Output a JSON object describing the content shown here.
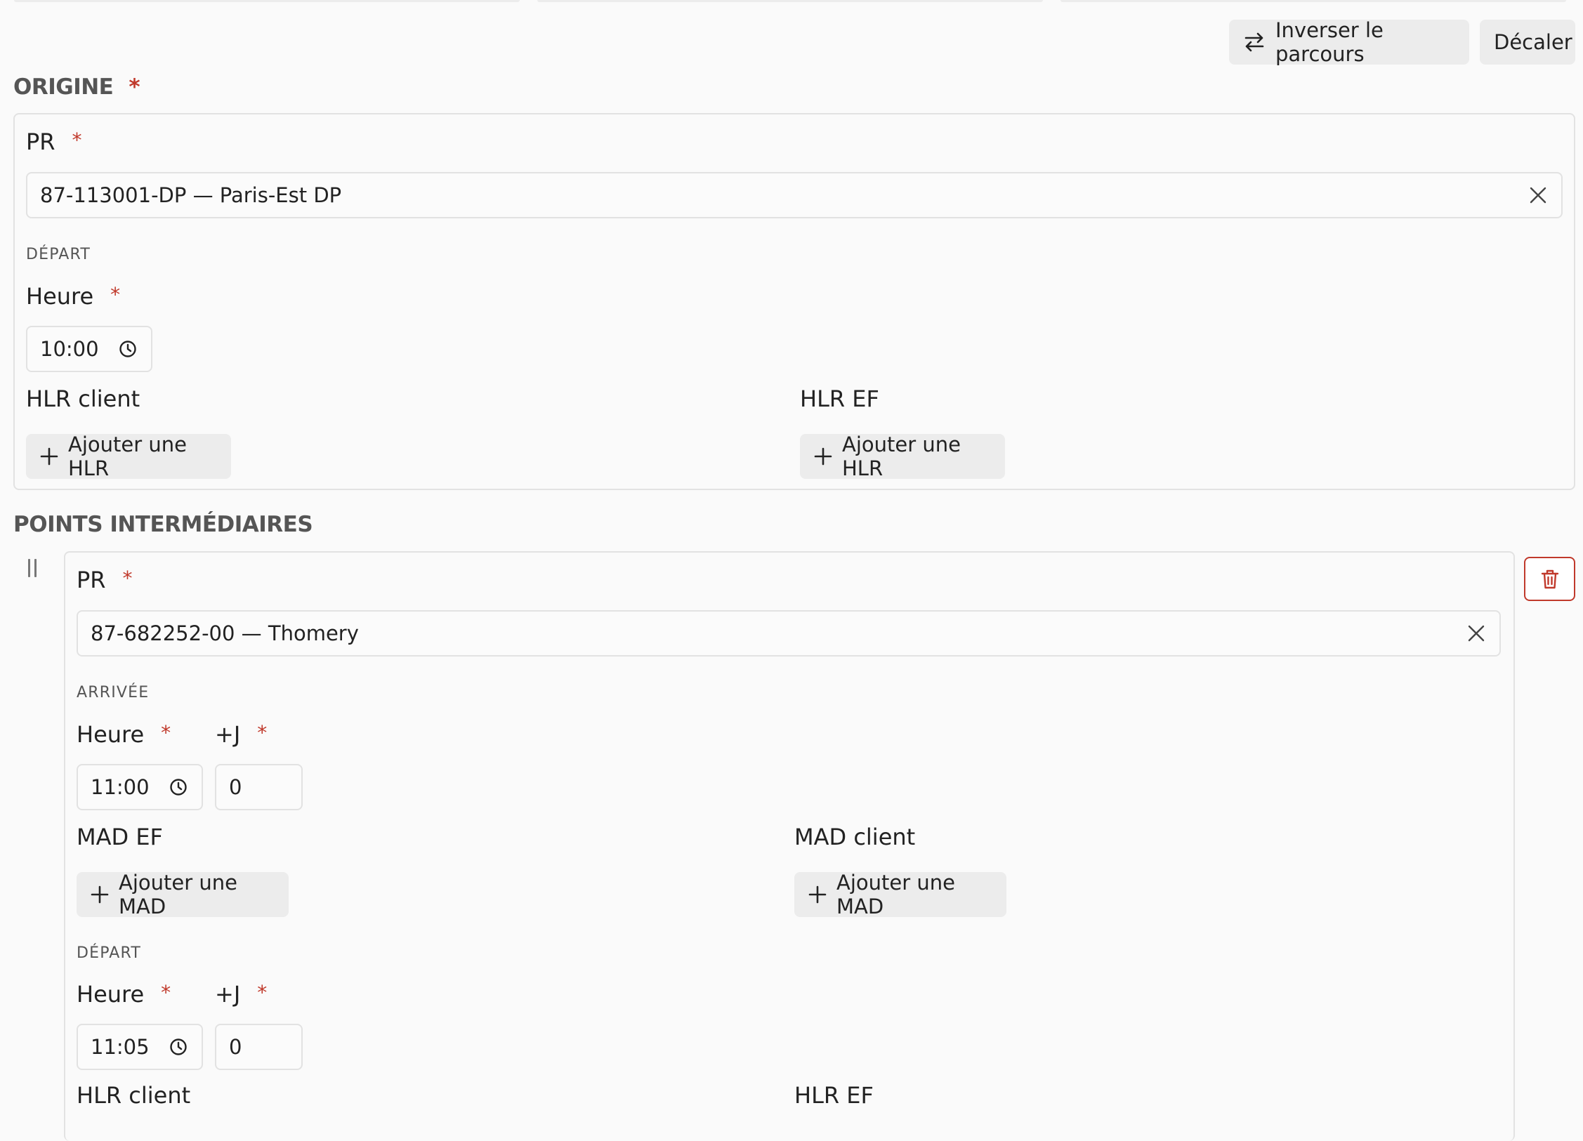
{
  "toolbar": {
    "invert_label": "Inverser le parcours",
    "shift_label": "Décaler"
  },
  "origine": {
    "title": "ORIGINE",
    "required_mark": "*",
    "pr_label": "PR",
    "pr_value": "87-113001-DP — Paris-Est DP",
    "depart_caption": "DÉPART",
    "heure_label": "Heure",
    "heure_value": "10:00",
    "hlr_client_label": "HLR client",
    "hlr_ef_label": "HLR EF",
    "add_hlr_label": "Ajouter une HLR"
  },
  "intermediaires": {
    "title": "POINTS INTERMÉDIAIRES",
    "point": {
      "pr_label": "PR",
      "pr_value": "87-682252-00 — Thomery",
      "arrivee_caption": "ARRIVÉE",
      "arrivee_heure_label": "Heure",
      "arrivee_heure_value": "11:00",
      "arrivee_j_label": "+J",
      "arrivee_j_value": "0",
      "mad_ef_label": "MAD EF",
      "mad_client_label": "MAD client",
      "add_mad_label": "Ajouter une MAD",
      "depart_caption": "DÉPART",
      "depart_heure_label": "Heure",
      "depart_heure_value": "11:05",
      "depart_j_label": "+J",
      "depart_j_value": "0",
      "hlr_client_label": "HLR client",
      "hlr_ef_label": "HLR EF"
    }
  },
  "colors": {
    "required": "#c0392b",
    "button_bg": "#ececec",
    "border": "#e2e2e2"
  },
  "icons": {
    "swap": "swap-arrows-icon",
    "clear": "close-icon",
    "clock": "clock-icon",
    "plus": "plus-icon",
    "trash": "trash-icon",
    "drag": "drag-handle-icon"
  }
}
